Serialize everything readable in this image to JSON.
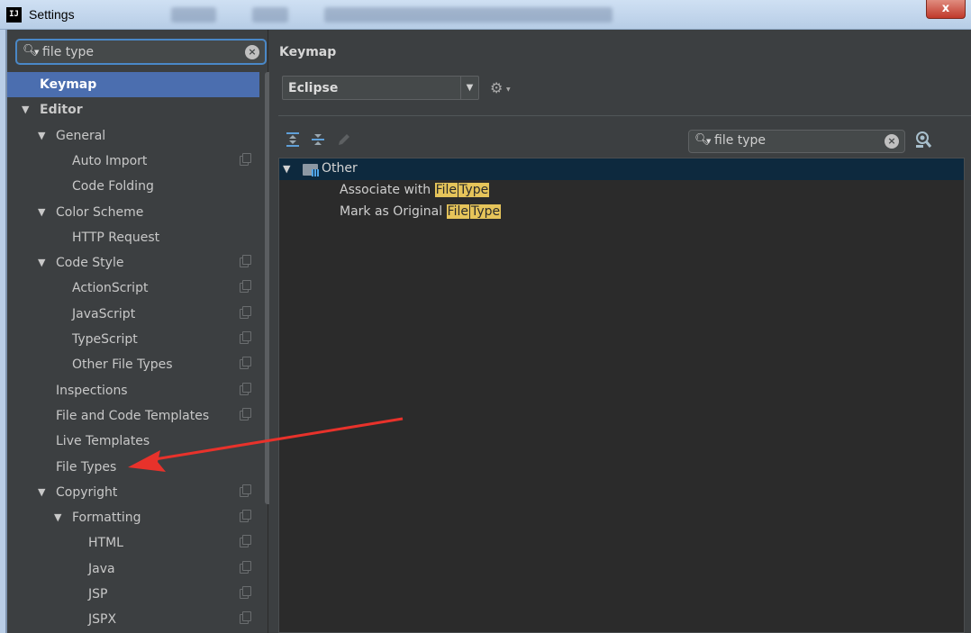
{
  "window": {
    "title": "Settings",
    "app_icon": "IJ",
    "close_label": "x"
  },
  "search": {
    "value": "file type"
  },
  "tree": [
    {
      "label": "Keymap",
      "depth": 0,
      "expanded": null,
      "selected": true,
      "copy": false
    },
    {
      "label": "Editor",
      "depth": 0,
      "expanded": true,
      "selected": false,
      "copy": false
    },
    {
      "label": "General",
      "depth": 1,
      "expanded": true,
      "copy": false
    },
    {
      "label": "Auto Import",
      "depth": 2,
      "copy": true
    },
    {
      "label": "Code Folding",
      "depth": 2,
      "copy": false
    },
    {
      "label": "Color Scheme",
      "depth": 1,
      "expanded": true,
      "copy": false
    },
    {
      "label": "HTTP Request",
      "depth": 2,
      "copy": false
    },
    {
      "label": "Code Style",
      "depth": 1,
      "expanded": true,
      "copy": true
    },
    {
      "label": "ActionScript",
      "depth": 2,
      "copy": true
    },
    {
      "label": "JavaScript",
      "depth": 2,
      "copy": true
    },
    {
      "label": "TypeScript",
      "depth": 2,
      "copy": true
    },
    {
      "label": "Other File Types",
      "depth": 2,
      "copy": true
    },
    {
      "label": "Inspections",
      "depth": 1,
      "copy": true
    },
    {
      "label": "File and Code Templates",
      "depth": 1,
      "copy": true
    },
    {
      "label": "Live Templates",
      "depth": 1,
      "copy": false
    },
    {
      "label": "File Types",
      "depth": 1,
      "copy": false
    },
    {
      "label": "Copyright",
      "depth": 1,
      "expanded": true,
      "copy": true
    },
    {
      "label": "Formatting",
      "depth": 2,
      "expanded": true,
      "copy": true
    },
    {
      "label": "HTML",
      "depth": 3,
      "copy": true
    },
    {
      "label": "Java",
      "depth": 3,
      "copy": true
    },
    {
      "label": "JSP",
      "depth": 3,
      "copy": true
    },
    {
      "label": "JSPX",
      "depth": 3,
      "copy": true
    }
  ],
  "keymap": {
    "heading": "Keymap",
    "scheme": "Eclipse",
    "search_value": "file type",
    "group": "Other",
    "actions": [
      {
        "prefix": "Associate with ",
        "hl1": "File",
        "hl2": "Type"
      },
      {
        "prefix": "Mark as Original ",
        "hl1": "File",
        "hl2": "Type"
      }
    ]
  },
  "colors": {
    "selection": "#4b6eaf",
    "highlight": "#e6c45a",
    "annotation_arrow": "#e8322b"
  }
}
